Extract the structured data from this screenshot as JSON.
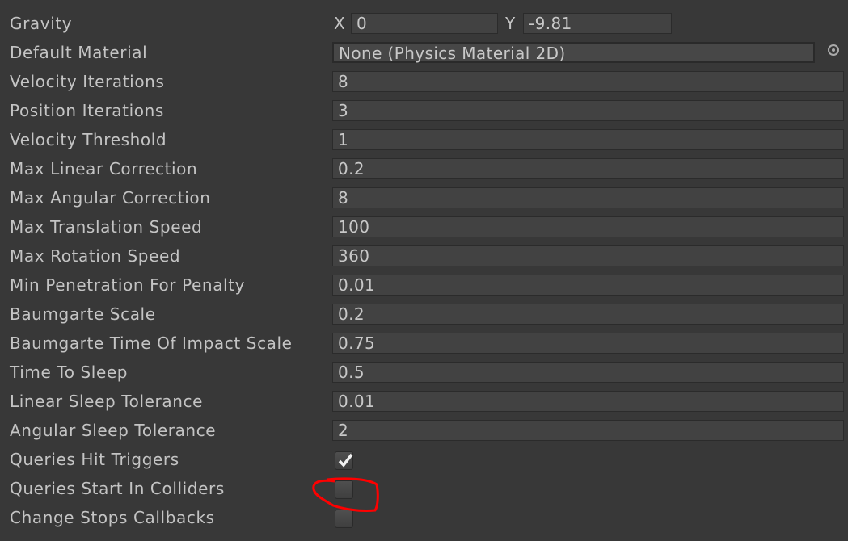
{
  "gravity": {
    "label": "Gravity",
    "x_label": "X",
    "x": "0",
    "y_label": "Y",
    "y": "-9.81"
  },
  "default_material": {
    "label": "Default Material",
    "value": "None (Physics Material 2D)",
    "icon": "object-picker-icon"
  },
  "fields": [
    {
      "label": "Velocity Iterations",
      "value": "8"
    },
    {
      "label": "Position Iterations",
      "value": "3"
    },
    {
      "label": "Velocity Threshold",
      "value": "1"
    },
    {
      "label": "Max Linear Correction",
      "value": "0.2"
    },
    {
      "label": "Max Angular Correction",
      "value": "8"
    },
    {
      "label": "Max Translation Speed",
      "value": "100"
    },
    {
      "label": "Max Rotation Speed",
      "value": "360"
    },
    {
      "label": "Min Penetration For Penalty",
      "value": "0.01"
    },
    {
      "label": "Baumgarte Scale",
      "value": "0.2"
    },
    {
      "label": "Baumgarte Time Of Impact Scale",
      "value": "0.75"
    },
    {
      "label": "Time To Sleep",
      "value": "0.5"
    },
    {
      "label": "Linear Sleep Tolerance",
      "value": "0.01"
    },
    {
      "label": "Angular Sleep Tolerance",
      "value": "2"
    }
  ],
  "checkboxes": [
    {
      "label": "Queries Hit Triggers",
      "checked": true
    },
    {
      "label": "Queries Start In Colliders",
      "checked": false
    },
    {
      "label": "Change Stops Callbacks",
      "checked": false
    }
  ],
  "annotation_color": "#ff0000"
}
